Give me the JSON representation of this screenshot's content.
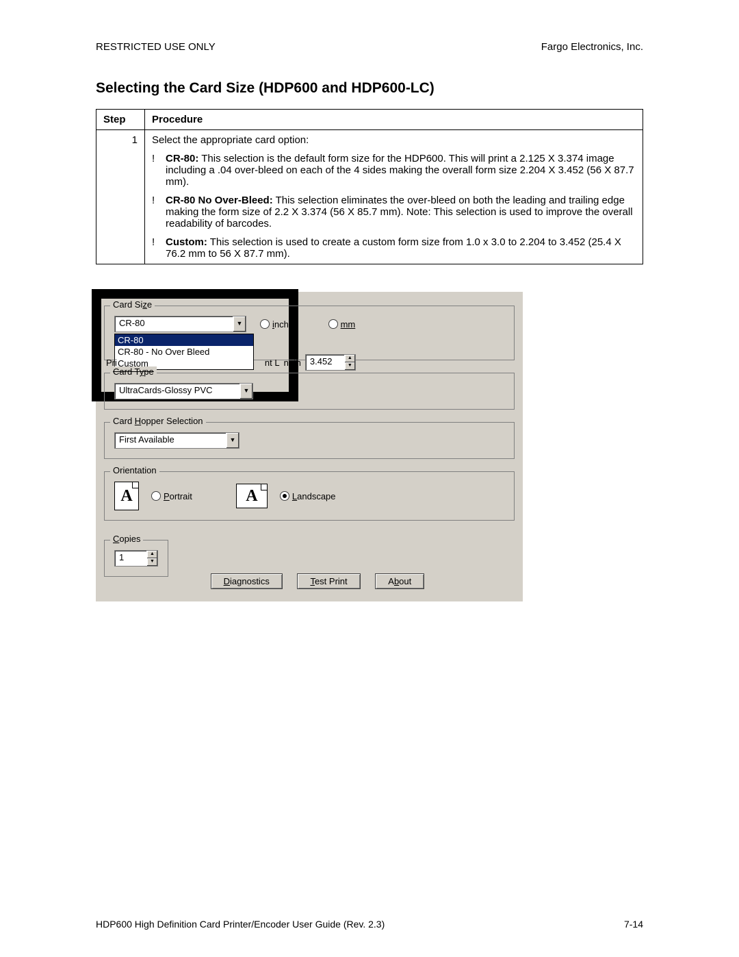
{
  "header": {
    "left": "RESTRICTED USE ONLY",
    "right": "Fargo Electronics, Inc."
  },
  "title": "Selecting the Card Size (HDP600 and HDP600-LC)",
  "table": {
    "head_step": "Step",
    "head_proc": "Procedure",
    "step_no": "1",
    "intro": "Select the appropriate card option:",
    "b1_label": "CR-80:",
    "b1_text": "  This selection is the default form size for the HDP600. This will print a 2.125 X 3.374 image including a .04 over-bleed on each of the 4 sides making the overall form size 2.204 X 3.452 (56 X 87.7 mm).",
    "b2_label": "CR-80 No Over-Bleed:",
    "b2_text": "  This selection eliminates the over-bleed on both the leading and trailing edge making the form size of 2.2 X 3.374 (56 X 85.7 mm). Note: This selection is used to improve the overall readability of barcodes.",
    "b3_label": "Custom:",
    "b3_text": "  This selection is used to create a custom form size from 1.0 x 3.0 to 2.204 to 3.452 (25.4 X 76.2 mm to 56 X 87.7 mm)."
  },
  "dlg": {
    "card_size_label": "Card Size",
    "combo_value": "CR-80",
    "options": [
      "CR-80",
      "CR-80 - No Over Bleed",
      "Custom"
    ],
    "unit_inches": "inches",
    "unit_mm": "mm",
    "print_prefix": "Pri",
    "length_fragment": "ngth",
    "length_prefix_frag": "nt L",
    "length_value": "3.452",
    "card_type_label": "Card Type",
    "card_type_label_cut": "Card Type",
    "card_type_value": "UltraCards-Glossy PVC",
    "hopper_label": "Card Hopper Selection",
    "hopper_value": "First Available",
    "orientation_label": "Orientation",
    "portrait": "Portrait",
    "landscape": "Landscape",
    "copies_label": "Copies",
    "copies_value": "1",
    "btn_diag": "Diagnostics",
    "btn_test": "Test Print",
    "btn_about": "About"
  },
  "footer": {
    "left": "HDP600 High Definition Card Printer/Encoder User Guide (Rev. 2.3)",
    "right": "7-14"
  }
}
